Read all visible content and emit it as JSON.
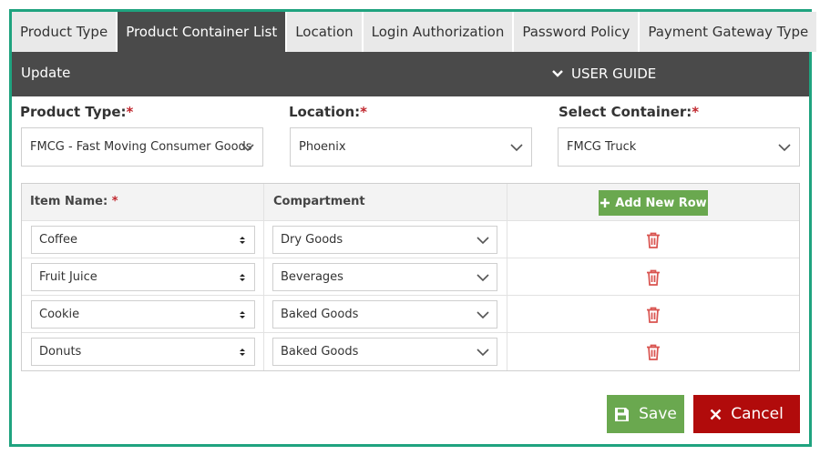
{
  "tabs": [
    {
      "label": "Product Type",
      "active": false
    },
    {
      "label": "Product Container List",
      "active": true
    },
    {
      "label": "Location",
      "active": false
    },
    {
      "label": "Login Authorization",
      "active": false
    },
    {
      "label": "Password Policy",
      "active": false
    },
    {
      "label": "Payment Gateway Type",
      "active": false
    }
  ],
  "header": {
    "title": "Update",
    "guide_label": "USER GUIDE"
  },
  "form": {
    "product_type": {
      "label": "Product Type:",
      "required_mark": "*",
      "value": "FMCG - Fast Moving Consumer Goods"
    },
    "location": {
      "label": "Location:",
      "required_mark": "*",
      "value": "Phoenix"
    },
    "container": {
      "label": "Select Container:",
      "required_mark": "*",
      "value": "FMCG Truck"
    }
  },
  "table": {
    "col_item": "Item Name:",
    "col_item_required": "*",
    "col_compartment": "Compartment",
    "add_button_label": "Add New Row",
    "rows": [
      {
        "item": "Coffee",
        "compartment": "Dry Goods"
      },
      {
        "item": "Fruit Juice",
        "compartment": "Beverages"
      },
      {
        "item": "Cookie",
        "compartment": "Baked Goods"
      },
      {
        "item": "Donuts",
        "compartment": "Baked Goods"
      }
    ]
  },
  "actions": {
    "save_label": "Save",
    "cancel_label": "Cancel"
  },
  "colors": {
    "frame_border": "#1fa37f",
    "dark_bar": "#4a4a4a",
    "green_button": "#6aa84f",
    "red_button": "#b10b0b",
    "required": "#c0262d",
    "trash": "#d9534f"
  },
  "icons": {
    "guide": "chevron-down-icon",
    "select_caret": "chevron-down-icon",
    "item_select": "up-down-arrows-icon",
    "add": "plus-icon",
    "row_delete": "trash-icon",
    "save": "floppy-disk-icon",
    "cancel": "close-icon"
  }
}
